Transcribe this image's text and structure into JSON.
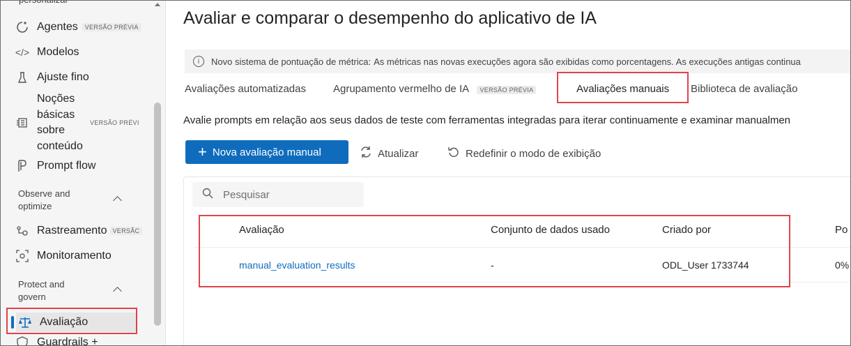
{
  "sidebar": {
    "top_cut": "personalizar",
    "items": [
      {
        "label": "Agentes",
        "icon": "agents-icon",
        "badge": "VERSÃO PRÉVIA"
      },
      {
        "label": "Modelos",
        "icon": "code-icon"
      },
      {
        "label": "Ajuste fino",
        "icon": "flask-icon"
      },
      {
        "label_lines": [
          "Noções",
          "básicas",
          "sobre",
          "conteúdo"
        ],
        "icon": "content-icon",
        "badge": "VERSÃO PRÉVI"
      },
      {
        "label": "Prompt flow",
        "icon": "flow-icon"
      },
      {
        "label": "Rastreamento",
        "icon": "tracing-icon",
        "badge": "VERSÃC"
      },
      {
        "label": "Monitoramento",
        "icon": "monitor-icon"
      },
      {
        "label": "Avaliação",
        "icon": "scale-icon",
        "selected": true
      },
      {
        "label": "Guardrails +",
        "icon": "shield-icon"
      }
    ],
    "sections": [
      {
        "label_lines": [
          "Observe and",
          "optimize"
        ]
      },
      {
        "label_lines": [
          "Protect and",
          "govern"
        ]
      }
    ]
  },
  "main": {
    "title": "Avaliar e comparar o desempenho do aplicativo de IA",
    "banner": {
      "bold": "Novo sistema de pontuação de métrica:",
      "text": "As métricas nas novas execuções agora são exibidas como porcentagens. As execuções antigas continua"
    },
    "tabs": [
      {
        "label": "Avaliações automatizadas"
      },
      {
        "label": "Agrupamento vermelho de IA",
        "badge": "VERSÃO PRÉVIA"
      },
      {
        "label": "Avaliações manuais",
        "active": true
      },
      {
        "label": "Biblioteca de avaliação"
      }
    ],
    "description": "Avalie prompts em relação aos seus dados de teste com ferramentas integradas para iterar continuamente e examinar manualmen",
    "toolbar": {
      "new_label": "Nova avaliação manual",
      "refresh_label": "Atualizar",
      "reset_label": "Redefinir o modo de exibição"
    },
    "search": {
      "placeholder": "Pesquisar"
    },
    "table": {
      "columns": [
        "Avaliação",
        "Conjunto de dados usado",
        "Criado por",
        "Po"
      ],
      "rows": [
        [
          "manual_evaluation_results",
          "-",
          "ODL_User 1733744",
          "0%"
        ]
      ]
    }
  },
  "colors": {
    "accent": "#0f6cbd",
    "highlight": "#e0434b"
  }
}
